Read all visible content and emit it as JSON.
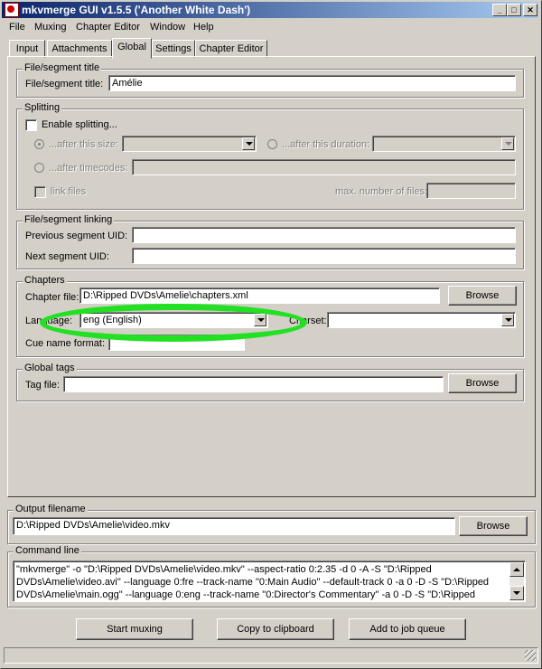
{
  "window": {
    "title": "mkvmerge GUI v1.5.5 ('Another White Dash')"
  },
  "menu": [
    "File",
    "Muxing",
    "Chapter Editor",
    "Window",
    "Help"
  ],
  "tabs": [
    "Input",
    "Attachments",
    "Global",
    "Settings",
    "Chapter Editor"
  ],
  "active_tab": "Global",
  "file_segment_title": {
    "group": "File/segment title",
    "label": "File/segment title:",
    "value": "Amélie"
  },
  "splitting": {
    "group": "Splitting",
    "enable_label": "Enable splitting...",
    "after_size_label": "...after this size:",
    "after_duration_label": "...after this duration:",
    "after_timecodes_label": "...after timecodes:",
    "link_files_label": "link files",
    "max_files_label": "max. number of files:"
  },
  "linking": {
    "group": "File/segment linking",
    "prev_label": "Previous segment UID:",
    "next_label": "Next segment UID:"
  },
  "chapters": {
    "group": "Chapters",
    "file_label": "Chapter file:",
    "file_value": "D:\\Ripped DVDs\\Amelie\\chapters.xml",
    "browse": "Browse",
    "language_label": "Language:",
    "language_value": "eng (English)",
    "charset_label": "Charset:",
    "cue_label": "Cue name format:"
  },
  "global_tags": {
    "group": "Global tags",
    "tag_file_label": "Tag file:",
    "browse": "Browse"
  },
  "output": {
    "group": "Output filename",
    "value": "D:\\Ripped DVDs\\Amelie\\video.mkv",
    "browse": "Browse"
  },
  "command": {
    "group": "Command line",
    "lines": [
      "\"mkvmerge\" -o \"D:\\Ripped DVDs\\Amelie\\video.mkv\" --aspect-ratio 0:2.35 -d 0 -A -S \"D:\\Ripped",
      "DVDs\\Amelie\\video.avi\" --language 0:fre --track-name \"0:Main Audio\" --default-track 0 -a 0 -D -S \"D:\\Ripped",
      "DVDs\\Amelie\\main.ogg\" --language 0:eng --track-name \"0:Director's Commentary\" -a 0 -D -S \"D:\\Ripped"
    ]
  },
  "actions": {
    "start": "Start muxing",
    "copy": "Copy to clipboard",
    "queue": "Add to job queue"
  },
  "colors": {
    "highlight": "#22e022",
    "titlebar": "#0a246a"
  }
}
